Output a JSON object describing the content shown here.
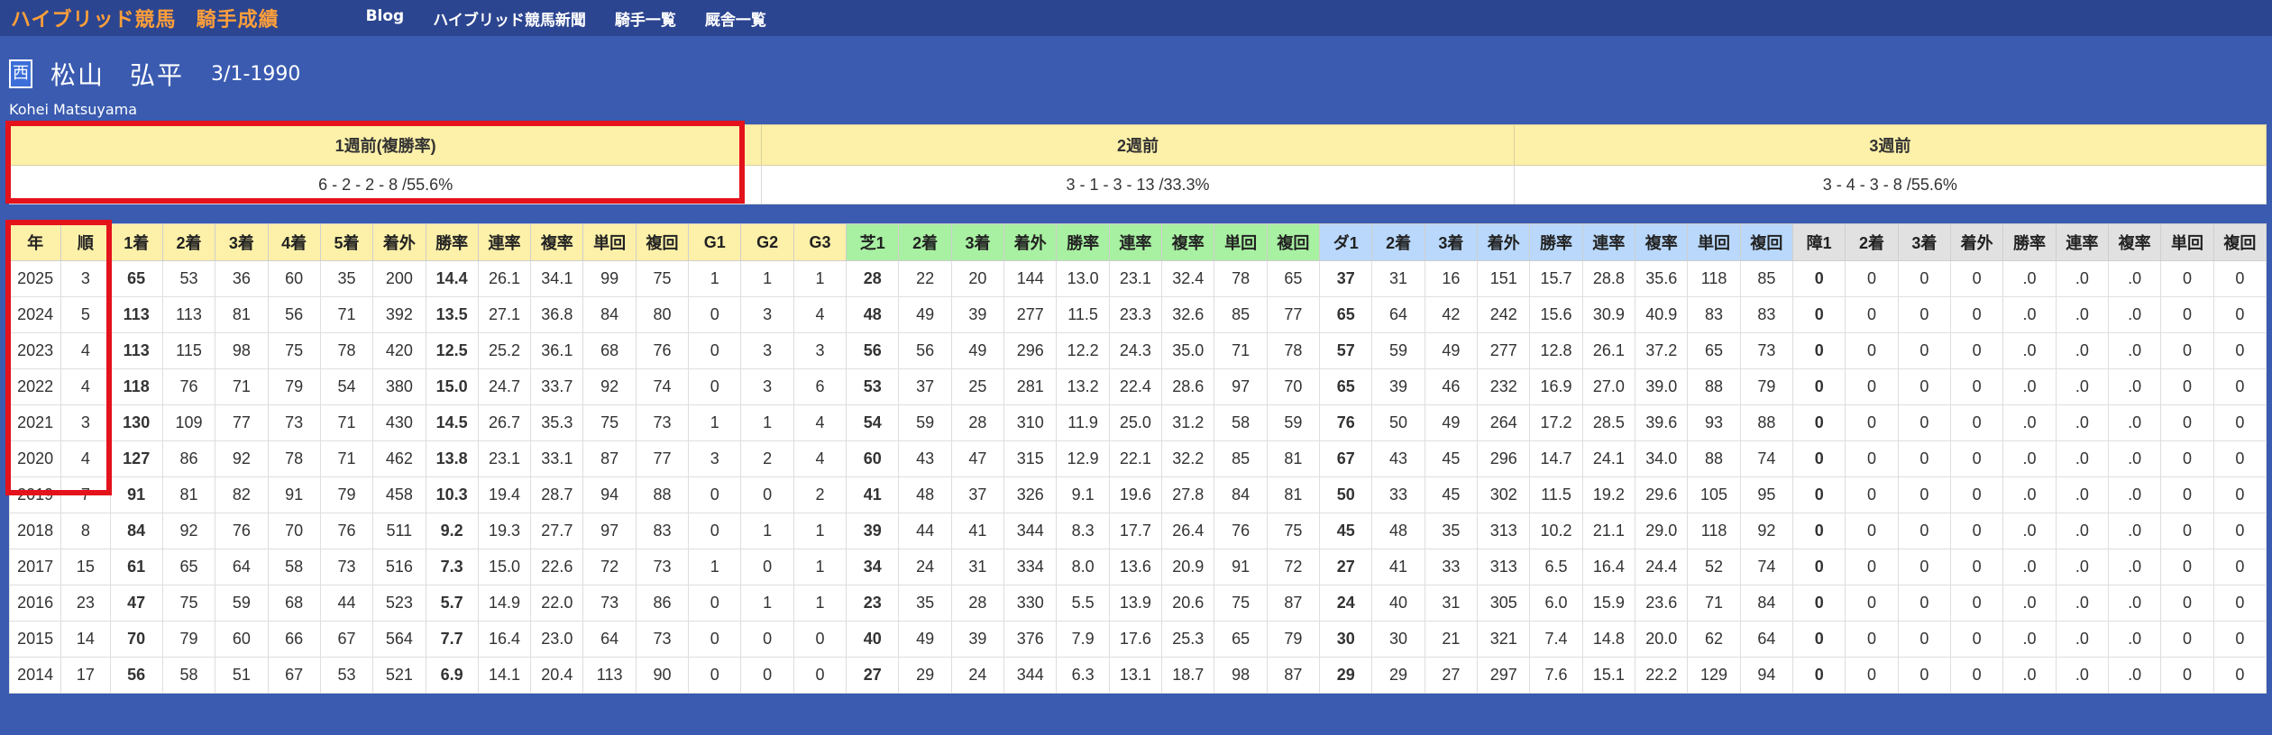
{
  "navbar": {
    "title": "ハイブリッド競馬",
    "subtitle": "騎手成績",
    "links": [
      "Blog",
      "ハイブリッド競馬新聞",
      "騎手一覧",
      "厩舎一覧"
    ]
  },
  "jockey": {
    "region": "西",
    "family_name": "松山",
    "given_name": "弘平",
    "birth": "3/1-1990",
    "romaji": "Kohei Matsuyama"
  },
  "weekly": {
    "headers": [
      "1週前(複勝率)",
      "2週前",
      "3週前"
    ],
    "values": [
      "6 - 2 - 2 - 8 /55.6%",
      "3 - 1 - 3 - 13 /33.3%",
      "3 - 4 - 3 - 8 /55.6%"
    ]
  },
  "stats": {
    "headers": [
      "年",
      "順",
      "1着",
      "2着",
      "3着",
      "4着",
      "5着",
      "着外",
      "勝率",
      "連率",
      "複率",
      "単回",
      "複回",
      "G1",
      "G2",
      "G3",
      "芝1",
      "2着",
      "3着",
      "着外",
      "勝率",
      "連率",
      "複率",
      "単回",
      "複回",
      "ダ1",
      "2着",
      "3着",
      "着外",
      "勝率",
      "連率",
      "複率",
      "単回",
      "複回",
      "障1",
      "2着",
      "3着",
      "着外",
      "勝率",
      "連率",
      "複率",
      "単回",
      "複回"
    ],
    "rows": [
      [
        "2025",
        "3",
        "65",
        "53",
        "36",
        "60",
        "35",
        "200",
        "14.4",
        "26.1",
        "34.1",
        "99",
        "75",
        "1",
        "1",
        "1",
        "28",
        "22",
        "20",
        "144",
        "13.0",
        "23.1",
        "32.4",
        "78",
        "65",
        "37",
        "31",
        "16",
        "151",
        "15.7",
        "28.8",
        "35.6",
        "118",
        "85",
        "0",
        "0",
        "0",
        "0",
        ".0",
        ".0",
        ".0",
        "0",
        "0"
      ],
      [
        "2024",
        "5",
        "113",
        "113",
        "81",
        "56",
        "71",
        "392",
        "13.5",
        "27.1",
        "36.8",
        "84",
        "80",
        "0",
        "3",
        "4",
        "48",
        "49",
        "39",
        "277",
        "11.5",
        "23.3",
        "32.6",
        "85",
        "77",
        "65",
        "64",
        "42",
        "242",
        "15.6",
        "30.9",
        "40.9",
        "83",
        "83",
        "0",
        "0",
        "0",
        "0",
        ".0",
        ".0",
        ".0",
        "0",
        "0"
      ],
      [
        "2023",
        "4",
        "113",
        "115",
        "98",
        "75",
        "78",
        "420",
        "12.5",
        "25.2",
        "36.1",
        "68",
        "76",
        "0",
        "3",
        "3",
        "56",
        "56",
        "49",
        "296",
        "12.2",
        "24.3",
        "35.0",
        "71",
        "78",
        "57",
        "59",
        "49",
        "277",
        "12.8",
        "26.1",
        "37.2",
        "65",
        "73",
        "0",
        "0",
        "0",
        "0",
        ".0",
        ".0",
        ".0",
        "0",
        "0"
      ],
      [
        "2022",
        "4",
        "118",
        "76",
        "71",
        "79",
        "54",
        "380",
        "15.0",
        "24.7",
        "33.7",
        "92",
        "74",
        "0",
        "3",
        "6",
        "53",
        "37",
        "25",
        "281",
        "13.2",
        "22.4",
        "28.6",
        "97",
        "70",
        "65",
        "39",
        "46",
        "232",
        "16.9",
        "27.0",
        "39.0",
        "88",
        "79",
        "0",
        "0",
        "0",
        "0",
        ".0",
        ".0",
        ".0",
        "0",
        "0"
      ],
      [
        "2021",
        "3",
        "130",
        "109",
        "77",
        "73",
        "71",
        "430",
        "14.5",
        "26.7",
        "35.3",
        "75",
        "73",
        "1",
        "1",
        "4",
        "54",
        "59",
        "28",
        "310",
        "11.9",
        "25.0",
        "31.2",
        "58",
        "59",
        "76",
        "50",
        "49",
        "264",
        "17.2",
        "28.5",
        "39.6",
        "93",
        "88",
        "0",
        "0",
        "0",
        "0",
        ".0",
        ".0",
        ".0",
        "0",
        "0"
      ],
      [
        "2020",
        "4",
        "127",
        "86",
        "92",
        "78",
        "71",
        "462",
        "13.8",
        "23.1",
        "33.1",
        "87",
        "77",
        "3",
        "2",
        "4",
        "60",
        "43",
        "47",
        "315",
        "12.9",
        "22.1",
        "32.2",
        "85",
        "81",
        "67",
        "43",
        "45",
        "296",
        "14.7",
        "24.1",
        "34.0",
        "88",
        "74",
        "0",
        "0",
        "0",
        "0",
        ".0",
        ".0",
        ".0",
        "0",
        "0"
      ],
      [
        "2019",
        "7",
        "91",
        "81",
        "82",
        "91",
        "79",
        "458",
        "10.3",
        "19.4",
        "28.7",
        "94",
        "88",
        "0",
        "0",
        "2",
        "41",
        "48",
        "37",
        "326",
        "9.1",
        "19.6",
        "27.8",
        "84",
        "81",
        "50",
        "33",
        "45",
        "302",
        "11.5",
        "19.2",
        "29.6",
        "105",
        "95",
        "0",
        "0",
        "0",
        "0",
        ".0",
        ".0",
        ".0",
        "0",
        "0"
      ],
      [
        "2018",
        "8",
        "84",
        "92",
        "76",
        "70",
        "76",
        "511",
        "9.2",
        "19.3",
        "27.7",
        "97",
        "83",
        "0",
        "1",
        "1",
        "39",
        "44",
        "41",
        "344",
        "8.3",
        "17.7",
        "26.4",
        "76",
        "75",
        "45",
        "48",
        "35",
        "313",
        "10.2",
        "21.1",
        "29.0",
        "118",
        "92",
        "0",
        "0",
        "0",
        "0",
        ".0",
        ".0",
        ".0",
        "0",
        "0"
      ],
      [
        "2017",
        "15",
        "61",
        "65",
        "64",
        "58",
        "73",
        "516",
        "7.3",
        "15.0",
        "22.6",
        "72",
        "73",
        "1",
        "0",
        "1",
        "34",
        "24",
        "31",
        "334",
        "8.0",
        "13.6",
        "20.9",
        "91",
        "72",
        "27",
        "41",
        "33",
        "313",
        "6.5",
        "16.4",
        "24.4",
        "52",
        "74",
        "0",
        "0",
        "0",
        "0",
        ".0",
        ".0",
        ".0",
        "0",
        "0"
      ],
      [
        "2016",
        "23",
        "47",
        "75",
        "59",
        "68",
        "44",
        "523",
        "5.7",
        "14.9",
        "22.0",
        "73",
        "86",
        "0",
        "1",
        "1",
        "23",
        "35",
        "28",
        "330",
        "5.5",
        "13.9",
        "20.6",
        "75",
        "87",
        "24",
        "40",
        "31",
        "305",
        "6.0",
        "15.9",
        "23.6",
        "71",
        "84",
        "0",
        "0",
        "0",
        "0",
        ".0",
        ".0",
        ".0",
        "0",
        "0"
      ],
      [
        "2015",
        "14",
        "70",
        "79",
        "60",
        "66",
        "67",
        "564",
        "7.7",
        "16.4",
        "23.0",
        "64",
        "73",
        "0",
        "0",
        "0",
        "40",
        "49",
        "39",
        "376",
        "7.9",
        "17.6",
        "25.3",
        "65",
        "79",
        "30",
        "30",
        "21",
        "321",
        "7.4",
        "14.8",
        "20.0",
        "62",
        "64",
        "0",
        "0",
        "0",
        "0",
        ".0",
        ".0",
        ".0",
        "0",
        "0"
      ],
      [
        "2014",
        "17",
        "56",
        "58",
        "51",
        "67",
        "53",
        "521",
        "6.9",
        "14.1",
        "20.4",
        "113",
        "90",
        "0",
        "0",
        "0",
        "27",
        "29",
        "24",
        "344",
        "6.3",
        "13.1",
        "18.7",
        "98",
        "87",
        "29",
        "29",
        "27",
        "297",
        "7.6",
        "15.1",
        "22.2",
        "129",
        "94",
        "0",
        "0",
        "0",
        "0",
        ".0",
        ".0",
        ".0",
        "0",
        "0"
      ]
    ]
  },
  "colors": {
    "background": "#3a5bb0",
    "navbar": "#2c4590",
    "title_orange": "#ff9f3a",
    "header_yellow": "#fdf0a8",
    "header_green": "#a8f0a2",
    "header_blue": "#b9d8fb",
    "header_gray": "#e1e1e1",
    "highlight_red": "#e3121b"
  }
}
